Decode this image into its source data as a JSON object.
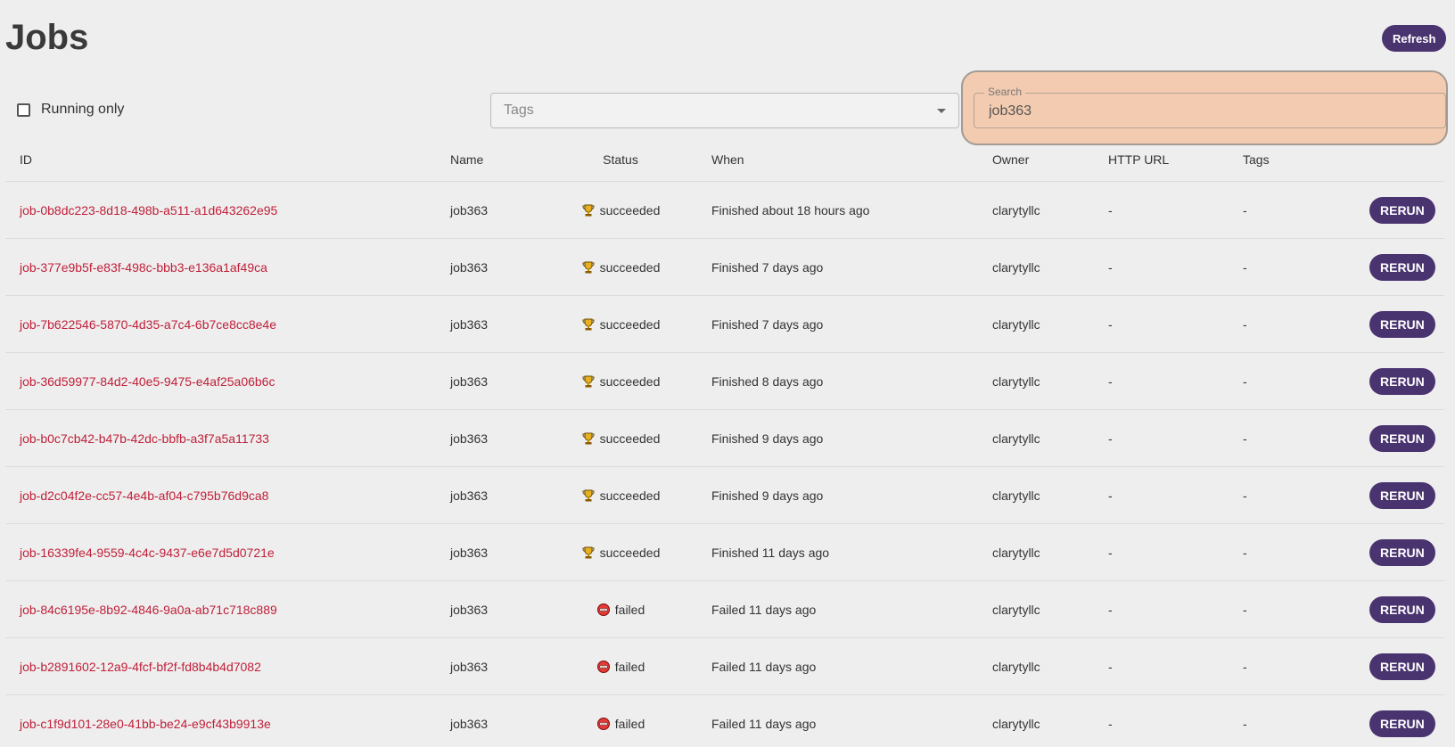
{
  "page": {
    "title": "Jobs",
    "refresh_label": "Refresh"
  },
  "filters": {
    "running_only_label": "Running only",
    "running_only_checked": false,
    "tags_placeholder": "Tags",
    "search_label": "Search",
    "search_value": "job363"
  },
  "table": {
    "headers": {
      "id": "ID",
      "name": "Name",
      "status": "Status",
      "when": "When",
      "owner": "Owner",
      "http_url": "HTTP URL",
      "tags": "Tags"
    },
    "action_label": "RERUN",
    "rows": [
      {
        "id": "job-0b8dc223-8d18-498b-a511-a1d643262e95",
        "name": "job363",
        "status": "succeeded",
        "status_icon": "trophy-icon",
        "when": "Finished about 18 hours ago",
        "owner": "clarytyllc",
        "http_url": "-",
        "tags": "-"
      },
      {
        "id": "job-377e9b5f-e83f-498c-bbb3-e136a1af49ca",
        "name": "job363",
        "status": "succeeded",
        "status_icon": "trophy-icon",
        "when": "Finished 7 days ago",
        "owner": "clarytyllc",
        "http_url": "-",
        "tags": "-"
      },
      {
        "id": "job-7b622546-5870-4d35-a7c4-6b7ce8cc8e4e",
        "name": "job363",
        "status": "succeeded",
        "status_icon": "trophy-icon",
        "when": "Finished 7 days ago",
        "owner": "clarytyllc",
        "http_url": "-",
        "tags": "-"
      },
      {
        "id": "job-36d59977-84d2-40e5-9475-e4af25a06b6c",
        "name": "job363",
        "status": "succeeded",
        "status_icon": "trophy-icon",
        "when": "Finished 8 days ago",
        "owner": "clarytyllc",
        "http_url": "-",
        "tags": "-"
      },
      {
        "id": "job-b0c7cb42-b47b-42dc-bbfb-a3f7a5a11733",
        "name": "job363",
        "status": "succeeded",
        "status_icon": "trophy-icon",
        "when": "Finished 9 days ago",
        "owner": "clarytyllc",
        "http_url": "-",
        "tags": "-"
      },
      {
        "id": "job-d2c04f2e-cc57-4e4b-af04-c795b76d9ca8",
        "name": "job363",
        "status": "succeeded",
        "status_icon": "trophy-icon",
        "when": "Finished 9 days ago",
        "owner": "clarytyllc",
        "http_url": "-",
        "tags": "-"
      },
      {
        "id": "job-16339fe4-9559-4c4c-9437-e6e7d5d0721e",
        "name": "job363",
        "status": "succeeded",
        "status_icon": "trophy-icon",
        "when": "Finished 11 days ago",
        "owner": "clarytyllc",
        "http_url": "-",
        "tags": "-"
      },
      {
        "id": "job-84c6195e-8b92-4846-9a0a-ab71c718c889",
        "name": "job363",
        "status": "failed",
        "status_icon": "failed-icon",
        "when": "Failed 11 days ago",
        "owner": "clarytyllc",
        "http_url": "-",
        "tags": "-"
      },
      {
        "id": "job-b2891602-12a9-4fcf-bf2f-fd8b4b4d7082",
        "name": "job363",
        "status": "failed",
        "status_icon": "failed-icon",
        "when": "Failed 11 days ago",
        "owner": "clarytyllc",
        "http_url": "-",
        "tags": "-"
      },
      {
        "id": "job-c1f9d101-28e0-41bb-be24-e9cf43b9913e",
        "name": "job363",
        "status": "failed",
        "status_icon": "failed-icon",
        "when": "Failed 11 days ago",
        "owner": "clarytyllc",
        "http_url": "-",
        "tags": "-"
      }
    ]
  },
  "colors": {
    "accent": "#4a3470",
    "link": "#c0203a",
    "highlight": "#f3cbb0",
    "background": "#eeeeee"
  }
}
